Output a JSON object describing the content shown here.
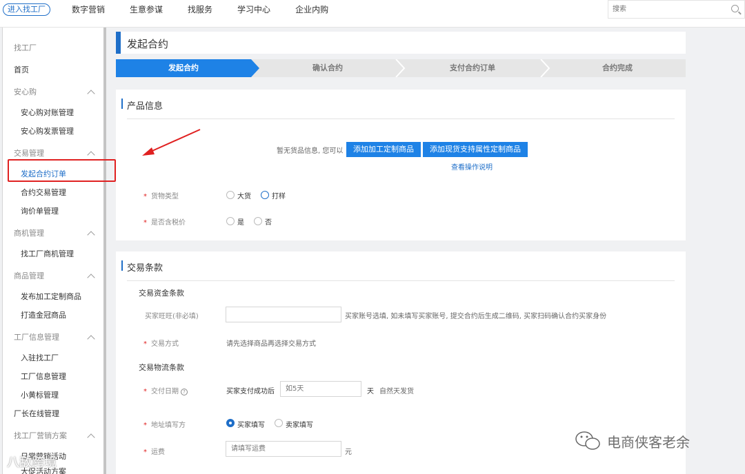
{
  "topbar": {
    "enter_label": "进入找工厂",
    "nav": [
      "数字营销",
      "生意参谋",
      "找服务",
      "学习中心",
      "企业内购"
    ],
    "search_placeholder": "搜索"
  },
  "sidebar": {
    "title": "找工厂",
    "home": "首页",
    "groups": [
      {
        "label": "安心购",
        "items": [
          "安心购对账管理",
          "安心购发票管理"
        ]
      },
      {
        "label": "交易管理",
        "items": [
          "发起合约订单",
          "合约交易管理",
          "询价单管理"
        ]
      },
      {
        "label": "商机管理",
        "items": [
          "找工厂商机管理"
        ]
      },
      {
        "label": "商品管理",
        "items": [
          "发布加工定制商品",
          "打造金冠商品"
        ]
      },
      {
        "label": "工厂信息管理",
        "items": [
          "入驻找工厂",
          "工厂信息管理",
          "小黄标管理"
        ]
      }
    ],
    "factory_online": "厂长在线管理",
    "marketing_group": "找工厂营销方案",
    "marketing_items": [
      "日常营销活动",
      "大促活动方案"
    ]
  },
  "page": {
    "title": "发起合约",
    "steps": [
      "发起合约",
      "确认合约",
      "支付合约订单",
      "合约完成"
    ]
  },
  "product": {
    "section_title": "产品信息",
    "empty_hint": "暂无货品信息, 您可以",
    "add_custom_btn": "添加加工定制商品",
    "add_stock_btn": "添加现货支持属性定制商品",
    "help_link": "查看操作说明",
    "goods_type_label": "货物类型",
    "goods_type_options": [
      "大货",
      "打样"
    ],
    "tax_label": "是否含税价",
    "tax_options": [
      "是",
      "否"
    ]
  },
  "trade": {
    "section_title": "交易条款",
    "fund_head": "交易资金条款",
    "buyer_label": "买家旺旺(非必填)",
    "buyer_hint": "买家账号选填, 如未填写买家账号, 提交合约后生成二维码, 买家扫码确认合约买家身份",
    "method_label": "交易方式",
    "method_hint": "请先选择商品再选择交易方式",
    "logistics_head": "交易物流条款",
    "delivery_label": "交付日期",
    "delivery_prefix": "买家支付成功后",
    "delivery_placeholder": "如5天",
    "delivery_unit": "天",
    "delivery_suffix": "自然天发货",
    "address_label": "地址填写方",
    "address_options": [
      "买家填写",
      "卖家填写"
    ],
    "freight_label": "运费",
    "freight_placeholder": "请填写运费",
    "freight_unit": "元"
  },
  "watermarks": {
    "left": "八敌跨境",
    "right": "电商侠客老余"
  },
  "colors": {
    "accent": "#1e6ec8",
    "button": "#1e82e6",
    "highlight": "#e02020"
  }
}
